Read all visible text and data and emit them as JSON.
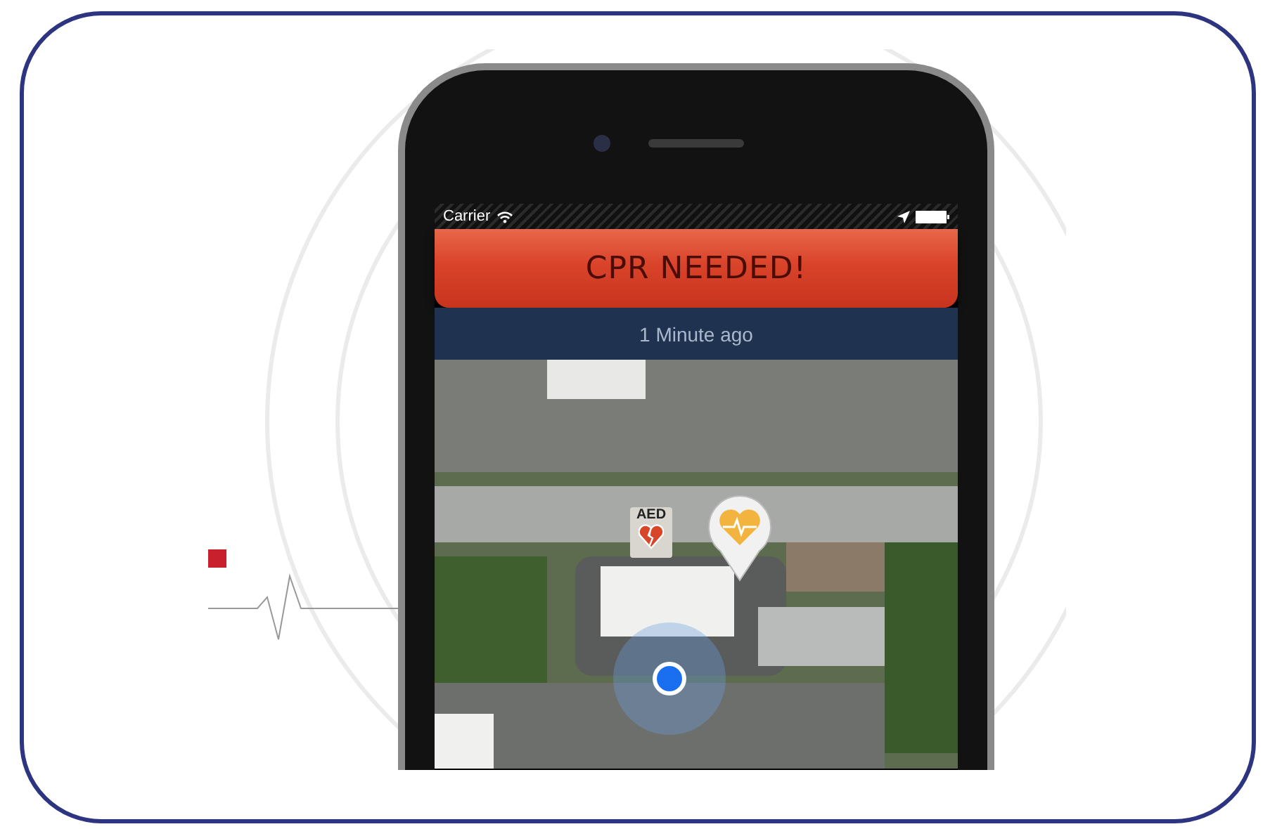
{
  "status_bar": {
    "carrier": "Carrier"
  },
  "alert": {
    "title": "CPR NEEDED!",
    "time": "1 Minute ago"
  },
  "map": {
    "markers": [
      {
        "kind": "aed",
        "label": "AED"
      },
      {
        "kind": "heart"
      },
      {
        "kind": "location"
      }
    ]
  }
}
